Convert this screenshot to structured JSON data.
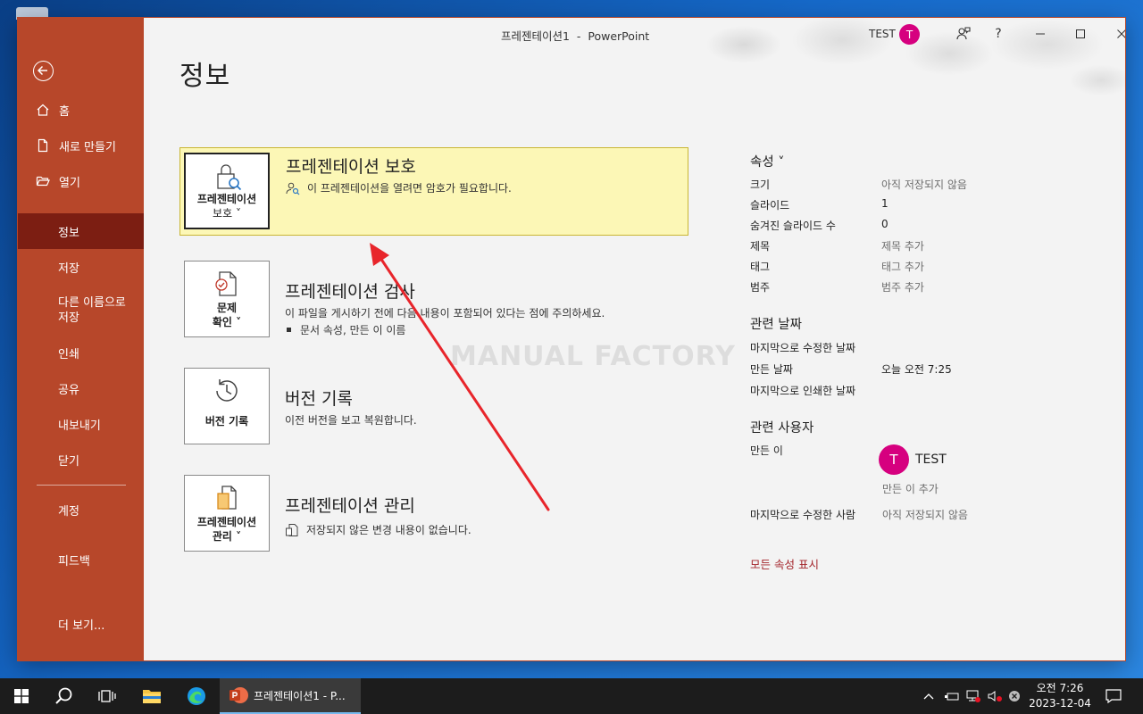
{
  "window": {
    "doc_title": "프레젠테이션1  -  PowerPoint",
    "user_name": "TEST",
    "user_initial": "T",
    "help_label": "?"
  },
  "nav": {
    "items": [
      {
        "label": "홈",
        "icon": "home-icon"
      },
      {
        "label": "새로 만들기",
        "icon": "new-doc-icon"
      },
      {
        "label": "열기",
        "icon": "folder-open-icon"
      },
      {
        "label": "정보"
      },
      {
        "label": "저장"
      },
      {
        "label": "다른 이름으로\n저장"
      },
      {
        "label": "인쇄"
      },
      {
        "label": "공유"
      },
      {
        "label": "내보내기"
      },
      {
        "label": "닫기"
      },
      {
        "label": "계정"
      },
      {
        "label": "피드백"
      },
      {
        "label": "더 보기..."
      }
    ],
    "active": "정보"
  },
  "page": {
    "title": "정보"
  },
  "cards": [
    {
      "button_label_line1": "프레젠테이션",
      "button_label_line2": "보호 ˅",
      "heading": "프레젠테이션 보호",
      "desc": "이 프레젠테이션을 열려면 암호가 필요합니다."
    },
    {
      "button_label_line1": "문제",
      "button_label_line2": "확인 ˅",
      "heading": "프레젠테이션 검사",
      "desc": "이 파일을 게시하기 전에 다음 내용이 포함되어 있다는 점에 주의하세요.",
      "bullet": "문서 속성, 만든 이 이름"
    },
    {
      "button_label_line1": "버전 기록",
      "heading": "버전 기록",
      "desc": "이전 버전을 보고 복원합니다."
    },
    {
      "button_label_line1": "프레젠테이션",
      "button_label_line2": "관리 ˅",
      "heading": "프레젠테이션 관리",
      "desc": "저장되지 않은 변경 내용이 없습니다."
    }
  ],
  "properties": {
    "heading": "속성 ˅",
    "rows": [
      {
        "key": "크기",
        "value": "아직 저장되지 않음"
      },
      {
        "key": "슬라이드",
        "value": "1"
      },
      {
        "key": "숨겨진 슬라이드 수",
        "value": "0"
      },
      {
        "key": "제목",
        "value": "제목 추가"
      },
      {
        "key": "태그",
        "value": "태그 추가"
      },
      {
        "key": "범주",
        "value": "범주 추가"
      }
    ],
    "dates_heading": "관련 날짜",
    "dates": [
      {
        "key": "마지막으로 수정한 날짜",
        "value": ""
      },
      {
        "key": "만든 날짜",
        "value": "오늘 오전 7:25"
      },
      {
        "key": "마지막으로 인쇄한 날짜",
        "value": ""
      }
    ],
    "people_heading": "관련 사용자",
    "author_key": "만든 이",
    "author_name": "TEST",
    "author_initial": "T",
    "add_author": "만든 이 추가",
    "last_modified_by_key": "마지막으로 수정한 사람",
    "last_modified_by_value": "아직 저장되지 않음",
    "show_all": "모든 속성 표시"
  },
  "watermark": "MANUAL FACTORY",
  "taskbar": {
    "app_label": "프레젠테이션1 - P...",
    "clock_time": "오전 7:26",
    "clock_date": "2023-12-04"
  },
  "colors": {
    "accent": "#b7472a",
    "nav_active": "#7c1e12",
    "highlight": "#fcf7b6",
    "avatar": "#d6007f",
    "link_red": "#a4262c"
  }
}
